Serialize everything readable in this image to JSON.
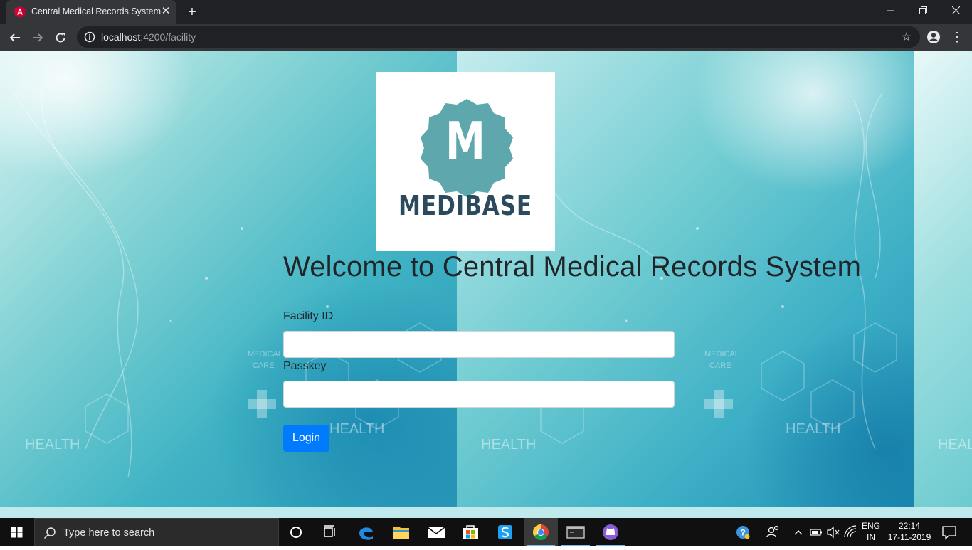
{
  "browser": {
    "tab_title": "Central Medical Records System",
    "url_host": "localhost",
    "url_path": ":4200/facility",
    "minimize_icon": "minimize-icon",
    "restore_icon": "restore-icon",
    "close_icon": "close-icon"
  },
  "page": {
    "logo_text": "MEDIBASE",
    "logo_letter": "M",
    "welcome": "Welcome to Central Medical Records System",
    "facility_label": "Facility ID",
    "facility_value": "",
    "passkey_label": "Passkey",
    "passkey_value": "",
    "login_label": "Login",
    "accent": "#007bff",
    "logo_color": "#5ea8ad",
    "logo_text_color": "#2c4a5e"
  },
  "taskbar": {
    "search_placeholder": "Type here to search",
    "lang_top": "ENG",
    "lang_bottom": "IN",
    "time": "22:14",
    "date": "17-11-2019"
  }
}
